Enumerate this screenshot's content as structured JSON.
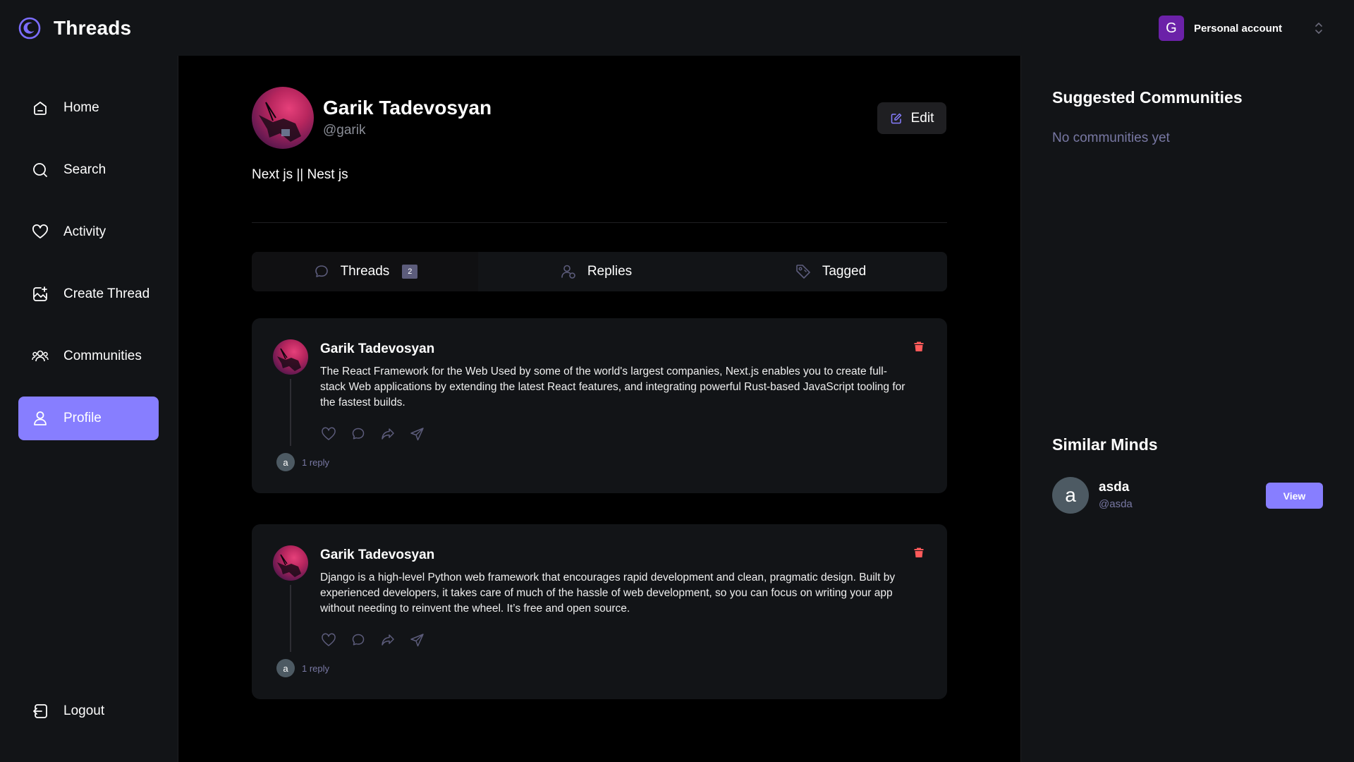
{
  "app": {
    "title": "Threads"
  },
  "account": {
    "initial": "G",
    "label": "Personal account"
  },
  "nav": {
    "items": [
      {
        "label": "Home",
        "icon": "home-icon"
      },
      {
        "label": "Search",
        "icon": "search-icon"
      },
      {
        "label": "Activity",
        "icon": "heart-icon"
      },
      {
        "label": "Create Thread",
        "icon": "create-thread-icon"
      },
      {
        "label": "Communities",
        "icon": "communities-icon"
      },
      {
        "label": "Profile",
        "icon": "user-icon",
        "active": true
      }
    ],
    "logout": "Logout"
  },
  "profile": {
    "name": "Garik Tadevosyan",
    "handle": "@garik",
    "bio": "Next js || Nest js",
    "edit_label": "Edit"
  },
  "tabs": [
    {
      "label": "Threads",
      "count": "2",
      "active": true
    },
    {
      "label": "Replies"
    },
    {
      "label": "Tagged"
    }
  ],
  "threads": [
    {
      "author": "Garik Tadevosyan",
      "text": "The React Framework for the Web Used by some of the world's largest companies, Next.js enables you to create full-stack Web applications by extending the latest React features, and integrating powerful Rust-based JavaScript tooling for the fastest builds.",
      "reply_initial": "a",
      "reply_count": "1 reply"
    },
    {
      "author": "Garik Tadevosyan",
      "text": "Django is a high-level Python web framework that encourages rapid development and clean, pragmatic design. Built by experienced developers, it takes care of much of the hassle of web development, so you can focus on writing your app without needing to reinvent the wheel. It’s free and open source.",
      "reply_initial": "a",
      "reply_count": "1 reply"
    }
  ],
  "rightbar": {
    "suggested_title": "Suggested Communities",
    "suggested_empty": "No communities yet",
    "similar_title": "Similar Minds",
    "similar": [
      {
        "initial": "a",
        "name": "asda",
        "handle": "@asda",
        "button": "View"
      }
    ]
  },
  "colors": {
    "background": "#121417",
    "main_background": "#000000",
    "accent": "#877eff",
    "delete": "#ff5a5a",
    "muted": "#7878a3"
  }
}
